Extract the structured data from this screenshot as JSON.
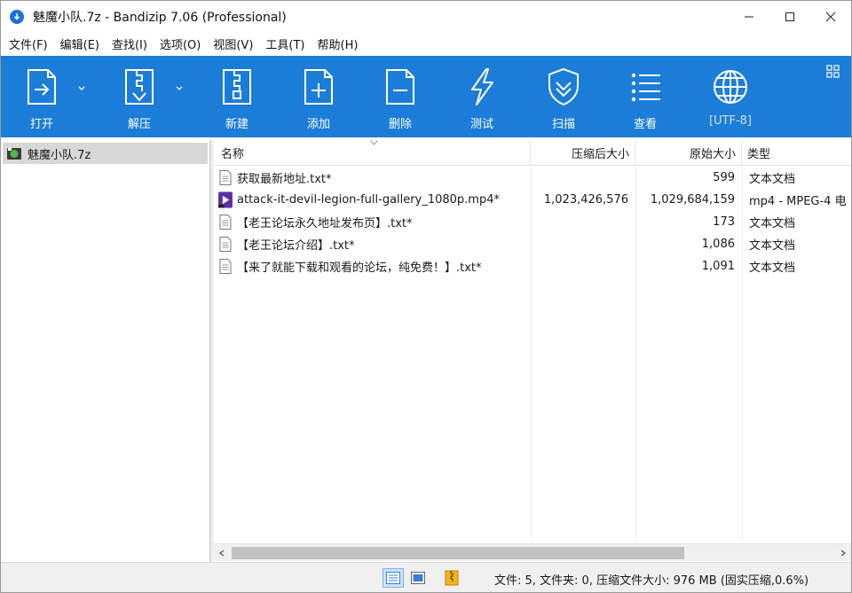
{
  "window": {
    "title": "魅魔小队.7z - Bandizip 7.06 (Professional)"
  },
  "menu": [
    "文件(F)",
    "编辑(E)",
    "查找(I)",
    "选项(O)",
    "视图(V)",
    "工具(T)",
    "帮助(H)"
  ],
  "toolbar": {
    "open": "打开",
    "extract": "解压",
    "new": "新建",
    "add": "添加",
    "delete": "删除",
    "test": "测试",
    "scan": "扫描",
    "view": "查看",
    "encoding": "[UTF-8]"
  },
  "tree": {
    "root": "魅魔小队.7z"
  },
  "columns": {
    "name": "名称",
    "compressed": "压缩后大小",
    "original": "原始大小",
    "type": "类型"
  },
  "files": [
    {
      "name": "获取最新地址.txt*",
      "compressed": "",
      "original": "599",
      "type": "文本文档",
      "icon": "text-file-icon"
    },
    {
      "name": "attack-it-devil-legion-full-gallery_1080p.mp4*",
      "compressed": "1,023,426,576",
      "original": "1,029,684,159",
      "type": "mp4 - MPEG-4 电",
      "icon": "video-file-icon"
    },
    {
      "name": "【老王论坛永久地址发布页】.txt*",
      "compressed": "",
      "original": "173",
      "type": "文本文档",
      "icon": "text-file-icon"
    },
    {
      "name": "【老王论坛介绍】.txt*",
      "compressed": "",
      "original": "1,086",
      "type": "文本文档",
      "icon": "text-file-icon"
    },
    {
      "name": "【来了就能下载和观看的论坛，纯免费！】.txt*",
      "compressed": "",
      "original": "1,091",
      "type": "文本文档",
      "icon": "text-file-icon"
    }
  ],
  "status": {
    "summary": "文件: 5, 文件夹: 0, 压缩文件大小: 976 MB (固实压缩,0.6%)"
  },
  "colors": {
    "toolbar": "#1c7dd8",
    "selection": "#d8d8d8"
  }
}
